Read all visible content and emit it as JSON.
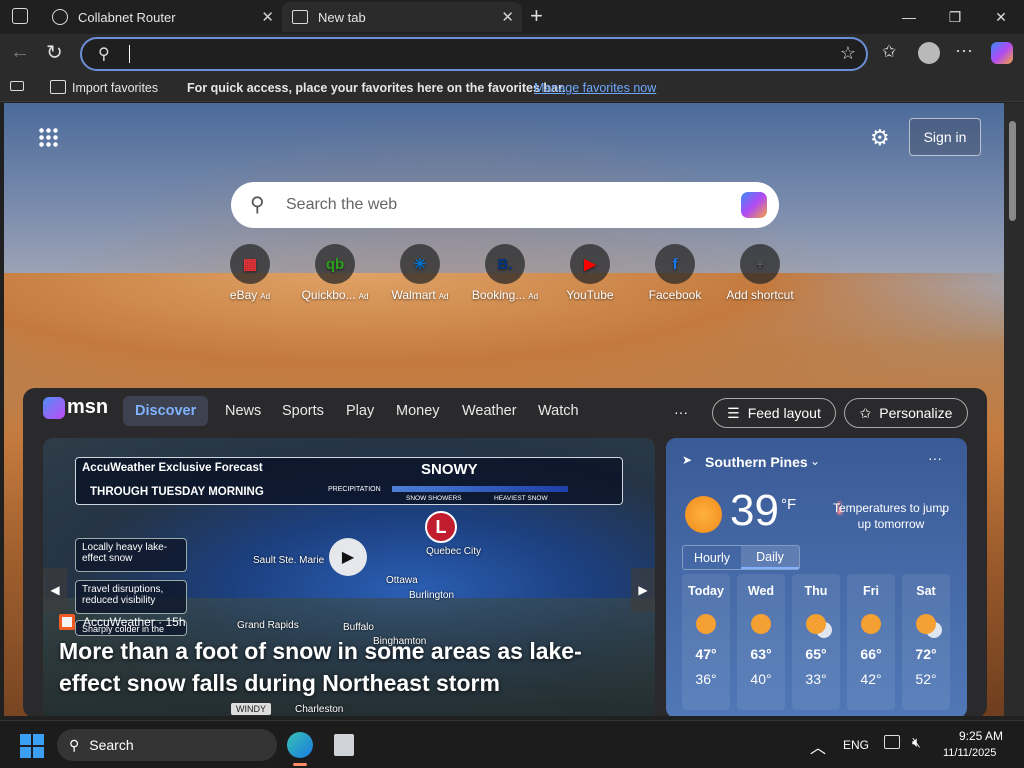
{
  "tabs": [
    {
      "title": "Collabnet Router"
    },
    {
      "title": "New tab"
    }
  ],
  "favorites_bar": {
    "import_label": "Import favorites",
    "hint": "For quick access, place your favorites here on the favorites bar.",
    "manage_link": "Manage favorites now"
  },
  "header": {
    "sign_in": "Sign in"
  },
  "search": {
    "placeholder": "Search the web"
  },
  "quick_links": [
    {
      "label": "eBay",
      "ad": "Ad",
      "glyph": "▦",
      "color": "#e53238"
    },
    {
      "label": "Quickbo...",
      "ad": "Ad",
      "glyph": "qb",
      "color": "#2ca01c"
    },
    {
      "label": "Walmart",
      "ad": "Ad",
      "glyph": "✳",
      "color": "#0071ce"
    },
    {
      "label": "Booking...",
      "ad": "Ad",
      "glyph": "B.",
      "color": "#003580"
    },
    {
      "label": "YouTube",
      "ad": "",
      "glyph": "▶",
      "color": "#ff0000"
    },
    {
      "label": "Facebook",
      "ad": "",
      "glyph": "f",
      "color": "#1877f2"
    },
    {
      "label": "Add shortcut",
      "ad": "",
      "glyph": "+",
      "color": "#555555"
    }
  ],
  "msn": {
    "logo": "msn",
    "nav": [
      "Discover",
      "News",
      "Sports",
      "Play",
      "Money",
      "Weather",
      "Watch"
    ],
    "more": "···",
    "feed_layout": "Feed layout",
    "personalize": "Personalize"
  },
  "hero": {
    "forecast_title": "AccuWeather Exclusive Forecast",
    "forecast_sub": "THROUGH TUESDAY MORNING",
    "condition": "SNOWY",
    "precip_label": "PRECIPITATION",
    "legend_a": "SNOW SHOWERS",
    "legend_b": "HEAVIEST SNOW",
    "note1": "Locally heavy lake-effect snow",
    "note2": "Travel disruptions, reduced visibility",
    "note3": "Sharply colder in the",
    "cities": [
      "Sault Ste. Marie",
      "Ottawa",
      "Quebec City",
      "Burlington",
      "Grand Rapids",
      "Buffalo",
      "Binghamton",
      "Charleston",
      "WINDY"
    ],
    "low_marker": "L",
    "source": "AccuWeather · 15h",
    "headline": "More than a foot of snow in some areas as lake-effect snow falls during Northeast storm"
  },
  "weather": {
    "location": "Southern Pines",
    "temp": "39",
    "unit": "°F",
    "alert": "Temperatures to jump up tomorrow",
    "tabs": [
      "Hourly",
      "Daily"
    ],
    "days": [
      {
        "day": "Today",
        "hi": "47°",
        "lo": "36°",
        "icon": "sun"
      },
      {
        "day": "Wed",
        "hi": "63°",
        "lo": "40°",
        "icon": "sun"
      },
      {
        "day": "Thu",
        "hi": "65°",
        "lo": "33°",
        "icon": "partly-cloudy"
      },
      {
        "day": "Fri",
        "hi": "66°",
        "lo": "42°",
        "icon": "sun"
      },
      {
        "day": "Sat",
        "hi": "72°",
        "lo": "52°",
        "icon": "partly-cloudy"
      }
    ]
  },
  "taskbar": {
    "search": "Search",
    "lang": "ENG",
    "time": "9:25 AM",
    "date": "11/11/2025"
  }
}
